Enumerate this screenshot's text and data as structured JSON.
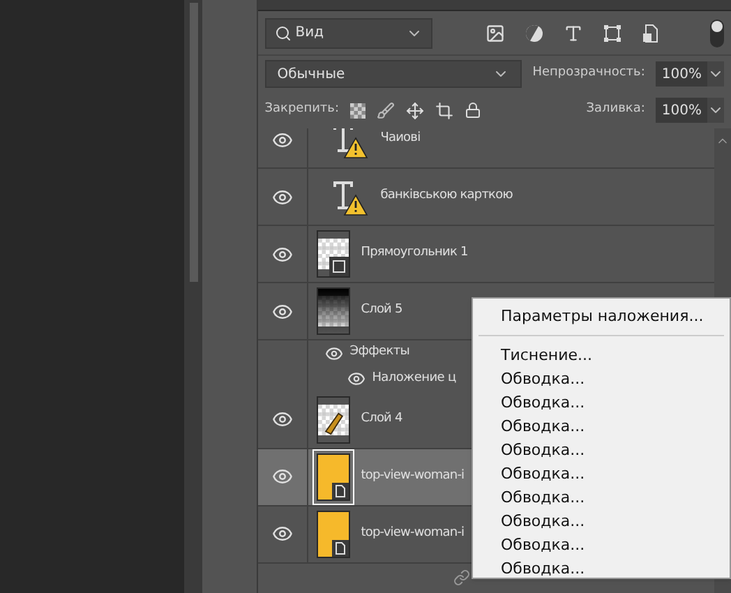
{
  "filter": {
    "value": "Вид"
  },
  "blend_mode": {
    "value": "Обычные"
  },
  "opacity": {
    "label": "Непрозрачность:",
    "value": "100%"
  },
  "lock": {
    "label": "Закрепить:"
  },
  "fill": {
    "label": "Заливка:",
    "value": "100%"
  },
  "layers": [
    {
      "kind": "text",
      "name": "Чаиові",
      "visible": true,
      "selected": false,
      "warning": true
    },
    {
      "kind": "text",
      "name": "банківською карткою",
      "visible": true,
      "selected": false,
      "warning": true
    },
    {
      "kind": "shape",
      "name": "Прямоугольник 1",
      "visible": true,
      "selected": false
    },
    {
      "kind": "gradient",
      "name": "Слой 5",
      "visible": true,
      "selected": false
    },
    {
      "kind": "effects",
      "name": "Эффекты",
      "visible": true
    },
    {
      "kind": "effect",
      "name": "Наложение ц",
      "visible": true
    },
    {
      "kind": "pixel",
      "name": "Слой 4",
      "visible": true,
      "selected": false
    },
    {
      "kind": "smart",
      "name": "top-view-woman-i",
      "visible": true,
      "selected": true
    },
    {
      "kind": "smart",
      "name": "top-view-woman-i",
      "visible": true,
      "selected": false
    }
  ],
  "context_menu": [
    {
      "kind": "item",
      "label": "Параметры наложения..."
    },
    {
      "kind": "separator"
    },
    {
      "kind": "item",
      "label": "Тиснение..."
    },
    {
      "kind": "item",
      "label": "Обводка..."
    },
    {
      "kind": "item",
      "label": "Обводка..."
    },
    {
      "kind": "item",
      "label": "Обводка..."
    },
    {
      "kind": "item",
      "label": "Обводка..."
    },
    {
      "kind": "item",
      "label": "Обводка..."
    },
    {
      "kind": "item",
      "label": "Обводка..."
    },
    {
      "kind": "item",
      "label": "Обводка..."
    },
    {
      "kind": "item",
      "label": "Обводка..."
    },
    {
      "kind": "item",
      "label": "Обводка..."
    }
  ]
}
